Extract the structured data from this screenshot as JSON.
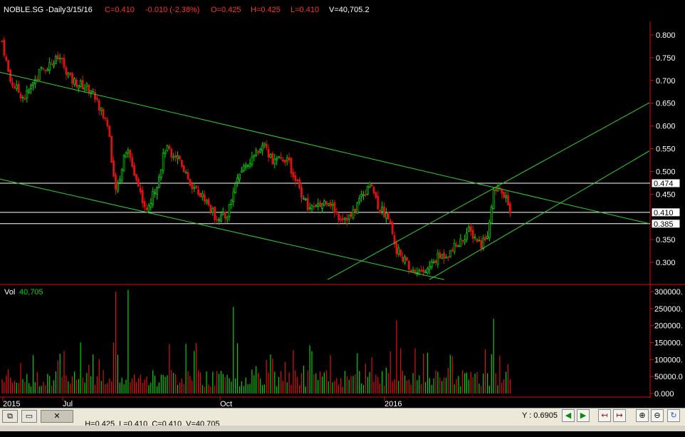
{
  "header": {
    "symbol": "NOBLE.SG -Daily",
    "date": "3/15/16",
    "close": "C=0.410",
    "change": "-0.010 (-2.38%)",
    "open": "O=0.425",
    "high": "H=0.425",
    "low": "L=0.410",
    "volume": "V=40,705.2"
  },
  "colors": {
    "background": "#000000",
    "up": "#00d400",
    "down": "#e01010",
    "trendline": "#30d030",
    "hline": "#ffffff",
    "axis": "#d01010",
    "header_text": "#ffffff",
    "header_red": "#ff3030"
  },
  "price_axis": {
    "ticks": [
      "0.800",
      "0.750",
      "0.700",
      "0.650",
      "0.600",
      "0.550",
      "0.500",
      "0.450",
      "0.350",
      "0.300"
    ],
    "markers": [
      "0.474",
      "0.410",
      "0.385"
    ]
  },
  "volume_panel": {
    "label": "Vol",
    "value": "40,705",
    "ticks": [
      "300000.",
      "250000.",
      "200000.",
      "150000.",
      "100000.",
      "50000.0",
      "0.000"
    ]
  },
  "x_axis": {
    "labels": [
      "2015",
      "Jul",
      "Oct",
      "2016"
    ]
  },
  "status_bar": {
    "open_label": "O=0.425",
    "high_label": "H=0.425",
    "low_label": "L=0.410",
    "close_label": "C=0.410",
    "vol_label": "V=40,705",
    "y_readout": "Y : 0.6905",
    "restore_icon": "restore-icon",
    "window_icon": "window-icon"
  },
  "chart_data": {
    "type": "candlestick",
    "symbol": "NOBLE.SG",
    "y_range": [
      0.26,
      0.82
    ],
    "volume_range": [
      0,
      300000
    ],
    "horizontal_levels": [
      0.474,
      0.41,
      0.385
    ],
    "waypoints": [
      [
        0.81,
        0
      ],
      [
        0.7,
        14
      ],
      [
        0.66,
        34
      ],
      [
        0.72,
        56
      ],
      [
        0.75,
        84
      ],
      [
        0.7,
        100
      ],
      [
        0.68,
        128
      ],
      [
        0.6,
        152
      ],
      [
        0.45,
        162
      ],
      [
        0.55,
        178
      ],
      [
        0.46,
        196
      ],
      [
        0.41,
        206
      ],
      [
        0.47,
        220
      ],
      [
        0.55,
        232
      ],
      [
        0.53,
        252
      ],
      [
        0.47,
        268
      ],
      [
        0.44,
        288
      ],
      [
        0.4,
        302
      ],
      [
        0.4,
        318
      ],
      [
        0.5,
        336
      ],
      [
        0.53,
        356
      ],
      [
        0.56,
        370
      ],
      [
        0.52,
        384
      ],
      [
        0.53,
        402
      ],
      [
        0.48,
        416
      ],
      [
        0.42,
        432
      ],
      [
        0.42,
        446
      ],
      [
        0.44,
        460
      ],
      [
        0.4,
        476
      ],
      [
        0.4,
        494
      ],
      [
        0.45,
        508
      ],
      [
        0.47,
        522
      ],
      [
        0.42,
        532
      ],
      [
        0.4,
        546
      ],
      [
        0.33,
        556
      ],
      [
        0.31,
        566
      ],
      [
        0.28,
        578
      ],
      [
        0.28,
        598
      ],
      [
        0.31,
        614
      ],
      [
        0.32,
        630
      ],
      [
        0.34,
        644
      ],
      [
        0.37,
        658
      ],
      [
        0.34,
        676
      ],
      [
        0.37,
        686
      ],
      [
        0.46,
        694
      ],
      [
        0.46,
        700
      ],
      [
        0.44,
        710
      ],
      [
        0.41,
        718
      ]
    ],
    "trendlines": [
      {
        "x1": 0,
        "y1": 0.718,
        "x2": 912,
        "y2": 0.385
      },
      {
        "x1": 0,
        "y1": 0.483,
        "x2": 624,
        "y2": 0.262
      },
      {
        "x1": 460,
        "y1": 0.262,
        "x2": 912,
        "y2": 0.651
      },
      {
        "x1": 603,
        "y1": 0.262,
        "x2": 912,
        "y2": 0.545
      }
    ]
  }
}
